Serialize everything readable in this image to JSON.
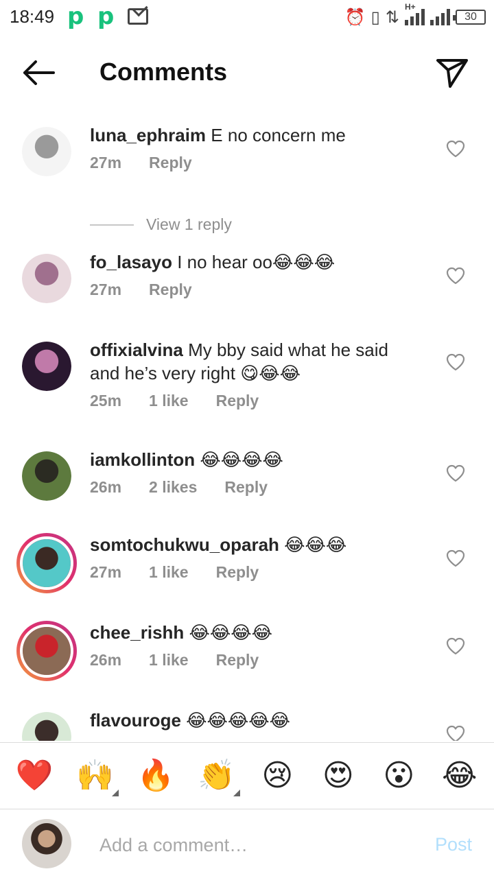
{
  "status_bar": {
    "time": "18:49",
    "app_icons": [
      "p-app-icon",
      "p-app-icon",
      "mail-icon"
    ],
    "right_icons": [
      "alarm-icon",
      "vibrate-icon",
      "data-transfer-icon",
      "signal-h-plus-icon",
      "signal-icon",
      "battery-icon"
    ],
    "network": "H+",
    "battery": "30"
  },
  "header": {
    "title": "Comments",
    "back_icon": "back-arrow-icon",
    "share_icon": "send-icon"
  },
  "comments": [
    {
      "username": "luna_ephraim",
      "text": "E no concern me",
      "time": "27m",
      "likes": "",
      "reply_label": "Reply",
      "view_replies": "View 1 reply",
      "avatar_ring": false,
      "avatar_colors": [
        "#f4f4f4",
        "#9a9a9a"
      ]
    },
    {
      "username": "fo_lasayo",
      "text": "I no hear oo😂😂😂",
      "time": "27m",
      "likes": "",
      "reply_label": "Reply",
      "avatar_ring": false,
      "avatar_colors": [
        "#e9d9de",
        "#a0708e"
      ]
    },
    {
      "username": "offixialvina",
      "text": "My bby said what he said and he’s very right 😋😂😂",
      "time": "25m",
      "likes": "1 like",
      "reply_label": "Reply",
      "avatar_ring": false,
      "avatar_colors": [
        "#2a1830",
        "#c07aa9"
      ]
    },
    {
      "username": "iamkollinton",
      "text": "😂😂😂😂",
      "time": "26m",
      "likes": "2 likes",
      "reply_label": "Reply",
      "avatar_ring": false,
      "avatar_colors": [
        "#5d7a3e",
        "#2b2b22"
      ]
    },
    {
      "username": "somtochukwu_oparah",
      "text": "😂😂😂",
      "time": "27m",
      "likes": "1 like",
      "reply_label": "Reply",
      "avatar_ring": true,
      "avatar_colors": [
        "#54c8c8",
        "#3b2a24"
      ]
    },
    {
      "username": "chee_rishh",
      "text": "😂😂😂😂",
      "time": "26m",
      "likes": "1 like",
      "reply_label": "Reply",
      "avatar_ring": true,
      "avatar_colors": [
        "#8b6a55",
        "#c9242b"
      ]
    },
    {
      "username": "flavouroge",
      "text": "😂😂😂😂😂",
      "time": "",
      "likes": "",
      "reply_label": "",
      "avatar_ring": false,
      "avatar_colors": [
        "#d8e9d6",
        "#3b2d2a"
      ]
    }
  ],
  "reactions": [
    {
      "emoji": "❤️",
      "name": "heart-emoji",
      "has_variants": false
    },
    {
      "emoji": "🙌",
      "name": "raising-hands-emoji",
      "has_variants": true
    },
    {
      "emoji": "🔥",
      "name": "fire-emoji",
      "has_variants": false
    },
    {
      "emoji": "👏",
      "name": "clapping-hands-emoji",
      "has_variants": true
    },
    {
      "emoji": "😢",
      "name": "crying-face-emoji",
      "has_variants": false
    },
    {
      "emoji": "😍",
      "name": "heart-eyes-emoji",
      "has_variants": false
    },
    {
      "emoji": "😮",
      "name": "surprised-face-emoji",
      "has_variants": false
    },
    {
      "emoji": "😂",
      "name": "tears-of-joy-emoji",
      "has_variants": false
    }
  ],
  "composer": {
    "placeholder": "Add a comment…",
    "post_label": "Post",
    "post_color": "#b2dffc"
  }
}
